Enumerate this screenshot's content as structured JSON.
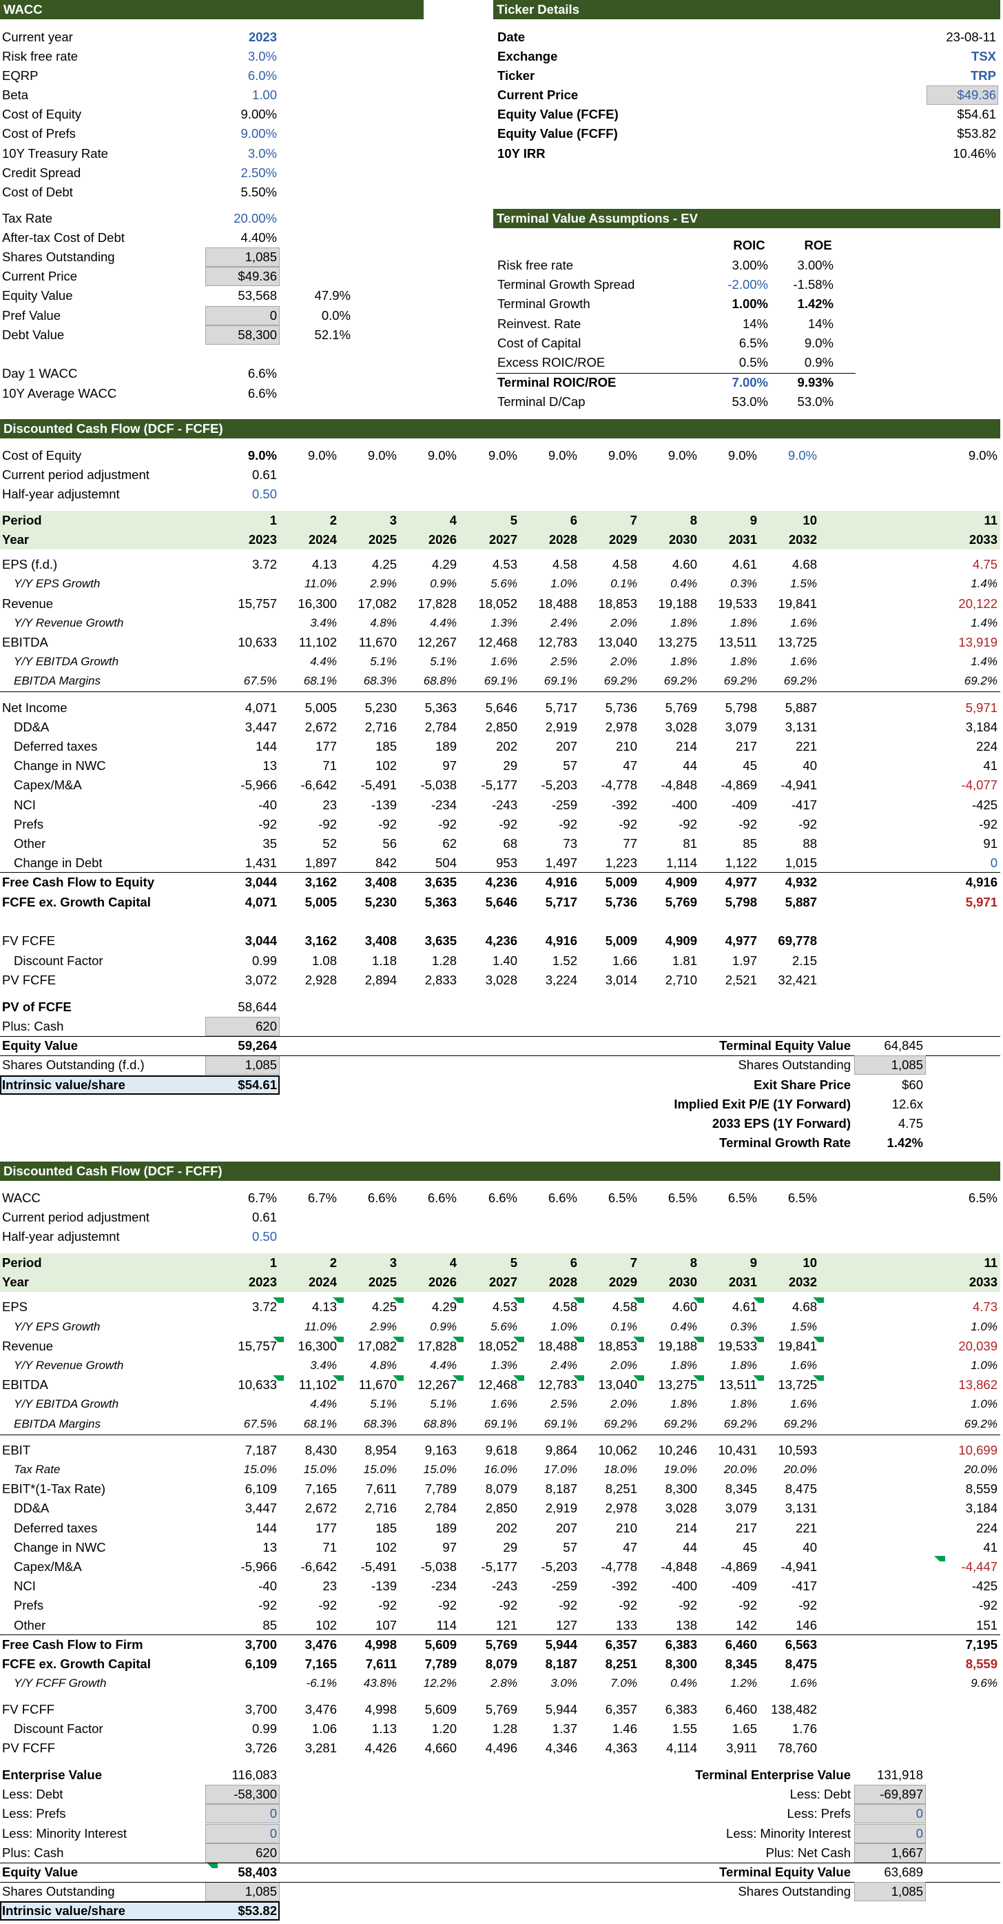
{
  "colors": {
    "header_bg": "#385723",
    "band_bg": "#e2efda",
    "input_gray": "#d9d9d9",
    "result_blue": "#ddebf7",
    "input_text_blue": "#2f5ea8",
    "red_text": "#b22222"
  },
  "wacc_title": "WACC",
  "wacc": [
    [
      "Current year",
      "2023"
    ],
    [
      "Risk free rate",
      "3.0%"
    ],
    [
      "EQRP",
      "6.0%"
    ],
    [
      "Beta",
      "1.00"
    ],
    [
      "Cost of Equity",
      "9.00%"
    ],
    [
      "Cost of Prefs",
      "9.00%"
    ],
    [
      "10Y Treasury Rate",
      "3.0%"
    ],
    [
      "Credit Spread",
      "2.50%"
    ],
    [
      "Cost of Debt",
      "5.50%"
    ],
    [
      "Tax Rate",
      "20.00%"
    ],
    [
      "After-tax Cost of Debt",
      "4.40%"
    ],
    [
      "Shares Outstanding",
      "1,085"
    ],
    [
      "Current Price",
      "$49.36"
    ],
    [
      "Equity Value",
      "53,568"
    ],
    [
      "Pref Value",
      "0"
    ],
    [
      "Debt Value",
      "58,300"
    ],
    [
      "Day 1 WACC",
      "6.6%"
    ],
    [
      "10Y Average WACC",
      "6.6%"
    ]
  ],
  "wacc_weights": [
    "47.9%",
    "0.0%",
    "52.1%"
  ],
  "ticker_title": "Ticker Details",
  "ticker": [
    [
      "Date",
      "23-08-11"
    ],
    [
      "Exchange",
      "TSX"
    ],
    [
      "Ticker",
      "TRP"
    ],
    [
      "Current Price",
      "$49.36"
    ],
    [
      "Equity Value (FCFE)",
      "$54.61"
    ],
    [
      "Equity Value (FCFF)",
      "$53.82"
    ],
    [
      "10Y IRR",
      "10.46%"
    ]
  ],
  "tv_title": "Terminal Value Assumptions - EV",
  "tv_cols": [
    "ROIC",
    "ROE"
  ],
  "tv": [
    [
      "Risk free rate",
      "3.00%",
      "3.00%"
    ],
    [
      "Terminal Growth Spread",
      "-2.00%",
      "-1.58%"
    ],
    [
      "Terminal Growth",
      "1.00%",
      "1.42%"
    ],
    [
      "Reinvest. Rate",
      "14%",
      "14%"
    ],
    [
      "Cost of Capital",
      "6.5%",
      "9.0%"
    ],
    [
      "Excess ROIC/ROE",
      "0.5%",
      "0.9%"
    ],
    [
      "Terminal ROIC/ROE",
      "7.00%",
      "9.93%"
    ],
    [
      "Terminal D/Cap",
      "53.0%",
      "53.0%"
    ]
  ],
  "fcfe": {
    "title": "Discounted Cash Flow (DCF - FCFE)",
    "top": [
      {
        "label": "Cost of Equity",
        "vals": [
          "9.0%",
          "9.0%",
          "9.0%",
          "9.0%",
          "9.0%",
          "9.0%",
          "9.0%",
          "9.0%",
          "9.0%",
          "9.0%",
          "9.0%"
        ]
      },
      {
        "label": "Current period adjustment",
        "vals": [
          "0.61"
        ]
      },
      {
        "label": "Half-year adjustemnt",
        "vals": [
          "0.50"
        ]
      }
    ],
    "period_label": "Period",
    "year_label": "Year",
    "periods": [
      "1",
      "2",
      "3",
      "4",
      "5",
      "6",
      "7",
      "8",
      "9",
      "10",
      "11"
    ],
    "years": [
      "2023",
      "2024",
      "2025",
      "2026",
      "2027",
      "2028",
      "2029",
      "2030",
      "2031",
      "2032",
      "2033"
    ],
    "g1": [
      {
        "label": "EPS (f.d.)",
        "vals": [
          "3.72",
          "4.13",
          "4.25",
          "4.29",
          "4.53",
          "4.58",
          "4.58",
          "4.60",
          "4.61",
          "4.68",
          "4.75"
        ]
      },
      {
        "label": "Y/Y EPS Growth",
        "vals": [
          "",
          "11.0%",
          "2.9%",
          "0.9%",
          "5.6%",
          "1.0%",
          "0.1%",
          "0.4%",
          "0.3%",
          "1.5%",
          "1.4%"
        ]
      },
      {
        "label": "Revenue",
        "vals": [
          "15,757",
          "16,300",
          "17,082",
          "17,828",
          "18,052",
          "18,488",
          "18,853",
          "19,188",
          "19,533",
          "19,841",
          "20,122"
        ]
      },
      {
        "label": "Y/Y Revenue Growth",
        "vals": [
          "",
          "3.4%",
          "4.8%",
          "4.4%",
          "1.3%",
          "2.4%",
          "2.0%",
          "1.8%",
          "1.8%",
          "1.6%",
          "1.4%"
        ]
      },
      {
        "label": "EBITDA",
        "vals": [
          "10,633",
          "11,102",
          "11,670",
          "12,267",
          "12,468",
          "12,783",
          "13,040",
          "13,275",
          "13,511",
          "13,725",
          "13,919"
        ]
      },
      {
        "label": "Y/Y EBITDA Growth",
        "vals": [
          "",
          "4.4%",
          "5.1%",
          "5.1%",
          "1.6%",
          "2.5%",
          "2.0%",
          "1.8%",
          "1.8%",
          "1.6%",
          "1.4%"
        ]
      },
      {
        "label": "EBITDA Margins",
        "vals": [
          "67.5%",
          "68.1%",
          "68.3%",
          "68.8%",
          "69.1%",
          "69.1%",
          "69.2%",
          "69.2%",
          "69.2%",
          "69.2%",
          "69.2%"
        ]
      }
    ],
    "g2": [
      {
        "label": "Net Income",
        "vals": [
          "4,071",
          "5,005",
          "5,230",
          "5,363",
          "5,646",
          "5,717",
          "5,736",
          "5,769",
          "5,798",
          "5,887",
          "5,971"
        ]
      },
      {
        "label": "DD&A",
        "vals": [
          "3,447",
          "2,672",
          "2,716",
          "2,784",
          "2,850",
          "2,919",
          "2,978",
          "3,028",
          "3,079",
          "3,131",
          "3,184"
        ]
      },
      {
        "label": "Deferred taxes",
        "vals": [
          "144",
          "177",
          "185",
          "189",
          "202",
          "207",
          "210",
          "214",
          "217",
          "221",
          "224"
        ]
      },
      {
        "label": "Change in NWC",
        "vals": [
          "13",
          "71",
          "102",
          "97",
          "29",
          "57",
          "47",
          "44",
          "45",
          "40",
          "41"
        ]
      },
      {
        "label": "Capex/M&A",
        "vals": [
          "-5,966",
          "-6,642",
          "-5,491",
          "-5,038",
          "-5,177",
          "-5,203",
          "-4,778",
          "-4,848",
          "-4,869",
          "-4,941",
          "-4,077"
        ]
      },
      {
        "label": "NCI",
        "vals": [
          "-40",
          "23",
          "-139",
          "-234",
          "-243",
          "-259",
          "-392",
          "-400",
          "-409",
          "-417",
          "-425"
        ]
      },
      {
        "label": "Prefs",
        "vals": [
          "-92",
          "-92",
          "-92",
          "-92",
          "-92",
          "-92",
          "-92",
          "-92",
          "-92",
          "-92",
          "-92"
        ]
      },
      {
        "label": "Other",
        "vals": [
          "35",
          "52",
          "56",
          "62",
          "68",
          "73",
          "77",
          "81",
          "85",
          "88",
          "91"
        ]
      },
      {
        "label": "Change in Debt",
        "vals": [
          "1,431",
          "1,897",
          "842",
          "504",
          "953",
          "1,497",
          "1,223",
          "1,114",
          "1,122",
          "1,015",
          "0"
        ]
      }
    ],
    "g3": [
      {
        "label": "Free Cash Flow to Equity",
        "vals": [
          "3,044",
          "3,162",
          "3,408",
          "3,635",
          "4,236",
          "4,916",
          "5,009",
          "4,909",
          "4,977",
          "4,932",
          "4,916"
        ]
      },
      {
        "label": "FCFE ex. Growth Capital",
        "vals": [
          "4,071",
          "5,005",
          "5,230",
          "5,363",
          "5,646",
          "5,717",
          "5,736",
          "5,769",
          "5,798",
          "5,887",
          "5,971"
        ]
      }
    ],
    "g4": [
      {
        "label": "FV FCFE",
        "vals": [
          "3,044",
          "3,162",
          "3,408",
          "3,635",
          "4,236",
          "4,916",
          "5,009",
          "4,909",
          "4,977",
          "69,778"
        ]
      },
      {
        "label": "Discount Factor",
        "vals": [
          "0.99",
          "1.08",
          "1.18",
          "1.28",
          "1.40",
          "1.52",
          "1.66",
          "1.81",
          "1.97",
          "2.15"
        ]
      },
      {
        "label": "PV FCFE",
        "vals": [
          "3,072",
          "2,928",
          "2,894",
          "2,833",
          "3,028",
          "3,224",
          "3,014",
          "2,710",
          "2,521",
          "32,421"
        ]
      }
    ],
    "summary": [
      [
        "PV of FCFE",
        "58,644"
      ],
      [
        "Plus: Cash",
        "620"
      ],
      [
        "Equity Value",
        "59,264"
      ],
      [
        "Shares Outstanding (f.d.)",
        "1,085"
      ],
      [
        "Intrinsic value/share",
        "$54.61"
      ]
    ],
    "terminal": [
      [
        "Terminal Equity Value",
        "64,845"
      ],
      [
        "Shares Outstanding",
        "1,085"
      ],
      [
        "Exit Share Price",
        "$60"
      ],
      [
        "Implied Exit P/E (1Y Forward)",
        "12.6x"
      ],
      [
        "2033 EPS (1Y Forward)",
        "4.75"
      ],
      [
        "Terminal Growth Rate",
        "1.42%"
      ]
    ]
  },
  "fcff": {
    "title": "Discounted Cash Flow (DCF - FCFF)",
    "top": [
      {
        "label": "WACC",
        "vals": [
          "6.7%",
          "6.7%",
          "6.6%",
          "6.6%",
          "6.6%",
          "6.6%",
          "6.5%",
          "6.5%",
          "6.5%",
          "6.5%",
          "6.5%"
        ]
      },
      {
        "label": "Current period adjustment",
        "vals": [
          "0.61"
        ]
      },
      {
        "label": "Half-year adjustemnt",
        "vals": [
          "0.50"
        ]
      }
    ],
    "period_label": "Period",
    "year_label": "Year",
    "periods": [
      "1",
      "2",
      "3",
      "4",
      "5",
      "6",
      "7",
      "8",
      "9",
      "10",
      "11"
    ],
    "years": [
      "2023",
      "2024",
      "2025",
      "2026",
      "2027",
      "2028",
      "2029",
      "2030",
      "2031",
      "2032",
      "2033"
    ],
    "g1": [
      {
        "label": "EPS",
        "vals": [
          "3.72",
          "4.13",
          "4.25",
          "4.29",
          "4.53",
          "4.58",
          "4.58",
          "4.60",
          "4.61",
          "4.68",
          "4.73"
        ]
      },
      {
        "label": "Y/Y EPS Growth",
        "vals": [
          "",
          "11.0%",
          "2.9%",
          "0.9%",
          "5.6%",
          "1.0%",
          "0.1%",
          "0.4%",
          "0.3%",
          "1.5%",
          "1.0%"
        ]
      },
      {
        "label": "Revenue",
        "vals": [
          "15,757",
          "16,300",
          "17,082",
          "17,828",
          "18,052",
          "18,488",
          "18,853",
          "19,188",
          "19,533",
          "19,841",
          "20,039"
        ]
      },
      {
        "label": "Y/Y Revenue Growth",
        "vals": [
          "",
          "3.4%",
          "4.8%",
          "4.4%",
          "1.3%",
          "2.4%",
          "2.0%",
          "1.8%",
          "1.8%",
          "1.6%",
          "1.0%"
        ]
      },
      {
        "label": "EBITDA",
        "vals": [
          "10,633",
          "11,102",
          "11,670",
          "12,267",
          "12,468",
          "12,783",
          "13,040",
          "13,275",
          "13,511",
          "13,725",
          "13,862"
        ]
      },
      {
        "label": "Y/Y EBITDA Growth",
        "vals": [
          "",
          "4.4%",
          "5.1%",
          "5.1%",
          "1.6%",
          "2.5%",
          "2.0%",
          "1.8%",
          "1.8%",
          "1.6%",
          "1.0%"
        ]
      },
      {
        "label": "EBITDA Margins",
        "vals": [
          "67.5%",
          "68.1%",
          "68.3%",
          "68.8%",
          "69.1%",
          "69.1%",
          "69.2%",
          "69.2%",
          "69.2%",
          "69.2%",
          "69.2%"
        ]
      }
    ],
    "g2": [
      {
        "label": "EBIT",
        "vals": [
          "7,187",
          "8,430",
          "8,954",
          "9,163",
          "9,618",
          "9,864",
          "10,062",
          "10,246",
          "10,431",
          "10,593",
          "10,699"
        ]
      },
      {
        "label": "Tax Rate",
        "vals": [
          "15.0%",
          "15.0%",
          "15.0%",
          "15.0%",
          "16.0%",
          "17.0%",
          "18.0%",
          "19.0%",
          "20.0%",
          "20.0%",
          "20.0%"
        ]
      },
      {
        "label": "EBIT*(1-Tax Rate)",
        "vals": [
          "6,109",
          "7,165",
          "7,611",
          "7,789",
          "8,079",
          "8,187",
          "8,251",
          "8,300",
          "8,345",
          "8,475",
          "8,559"
        ]
      },
      {
        "label": "DD&A",
        "vals": [
          "3,447",
          "2,672",
          "2,716",
          "2,784",
          "2,850",
          "2,919",
          "2,978",
          "3,028",
          "3,079",
          "3,131",
          "3,184"
        ]
      },
      {
        "label": "Deferred taxes",
        "vals": [
          "144",
          "177",
          "185",
          "189",
          "202",
          "207",
          "210",
          "214",
          "217",
          "221",
          "224"
        ]
      },
      {
        "label": "Change in NWC",
        "vals": [
          "13",
          "71",
          "102",
          "97",
          "29",
          "57",
          "47",
          "44",
          "45",
          "40",
          "41"
        ]
      },
      {
        "label": "Capex/M&A",
        "vals": [
          "-5,966",
          "-6,642",
          "-5,491",
          "-5,038",
          "-5,177",
          "-5,203",
          "-4,778",
          "-4,848",
          "-4,869",
          "-4,941",
          "-4,447"
        ]
      },
      {
        "label": "NCI",
        "vals": [
          "-40",
          "23",
          "-139",
          "-234",
          "-243",
          "-259",
          "-392",
          "-400",
          "-409",
          "-417",
          "-425"
        ]
      },
      {
        "label": "Prefs",
        "vals": [
          "-92",
          "-92",
          "-92",
          "-92",
          "-92",
          "-92",
          "-92",
          "-92",
          "-92",
          "-92",
          "-92"
        ]
      },
      {
        "label": "Other",
        "vals": [
          "85",
          "102",
          "107",
          "114",
          "121",
          "127",
          "133",
          "138",
          "142",
          "146",
          "151"
        ]
      }
    ],
    "g3": [
      {
        "label": "Free Cash Flow to Firm",
        "vals": [
          "3,700",
          "3,476",
          "4,998",
          "5,609",
          "5,769",
          "5,944",
          "6,357",
          "6,383",
          "6,460",
          "6,563",
          "7,195"
        ]
      },
      {
        "label": "FCFE ex. Growth Capital",
        "vals": [
          "6,109",
          "7,165",
          "7,611",
          "7,789",
          "8,079",
          "8,187",
          "8,251",
          "8,300",
          "8,345",
          "8,475",
          "8,559"
        ]
      },
      {
        "label": "Y/Y FCFF Growth",
        "vals": [
          "",
          "-6.1%",
          "43.8%",
          "12.2%",
          "2.8%",
          "3.0%",
          "7.0%",
          "0.4%",
          "1.2%",
          "1.6%",
          "9.6%"
        ]
      }
    ],
    "g4": [
      {
        "label": "FV FCFF",
        "vals": [
          "3,700",
          "3,476",
          "4,998",
          "5,609",
          "5,769",
          "5,944",
          "6,357",
          "6,383",
          "6,460",
          "138,482"
        ]
      },
      {
        "label": "Discount Factor",
        "vals": [
          "0.99",
          "1.06",
          "1.13",
          "1.20",
          "1.28",
          "1.37",
          "1.46",
          "1.55",
          "1.65",
          "1.76"
        ]
      },
      {
        "label": "PV FCFF",
        "vals": [
          "3,726",
          "3,281",
          "4,426",
          "4,660",
          "4,496",
          "4,346",
          "4,363",
          "4,114",
          "3,911",
          "78,760"
        ]
      }
    ],
    "summary": [
      [
        "Enterprise Value",
        "116,083"
      ],
      [
        "Less: Debt",
        "-58,300"
      ],
      [
        "Less: Prefs",
        "0"
      ],
      [
        "Less: Minority Interest",
        "0"
      ],
      [
        "Plus: Cash",
        "620"
      ],
      [
        "Equity Value",
        "58,403"
      ],
      [
        "Shares Outstanding",
        "1,085"
      ],
      [
        "Intrinsic value/share",
        "$53.82"
      ]
    ],
    "terminal": [
      [
        "Terminal Enterprise Value",
        "131,918"
      ],
      [
        "Less: Debt",
        "-69,897"
      ],
      [
        "Less: Prefs",
        "0"
      ],
      [
        "Less: Minority Interest",
        "0"
      ],
      [
        "Plus: Net Cash",
        "1,667"
      ],
      [
        "Terminal Equity Value",
        "63,689"
      ],
      [
        "Shares Outstanding",
        "1,085"
      ]
    ]
  }
}
